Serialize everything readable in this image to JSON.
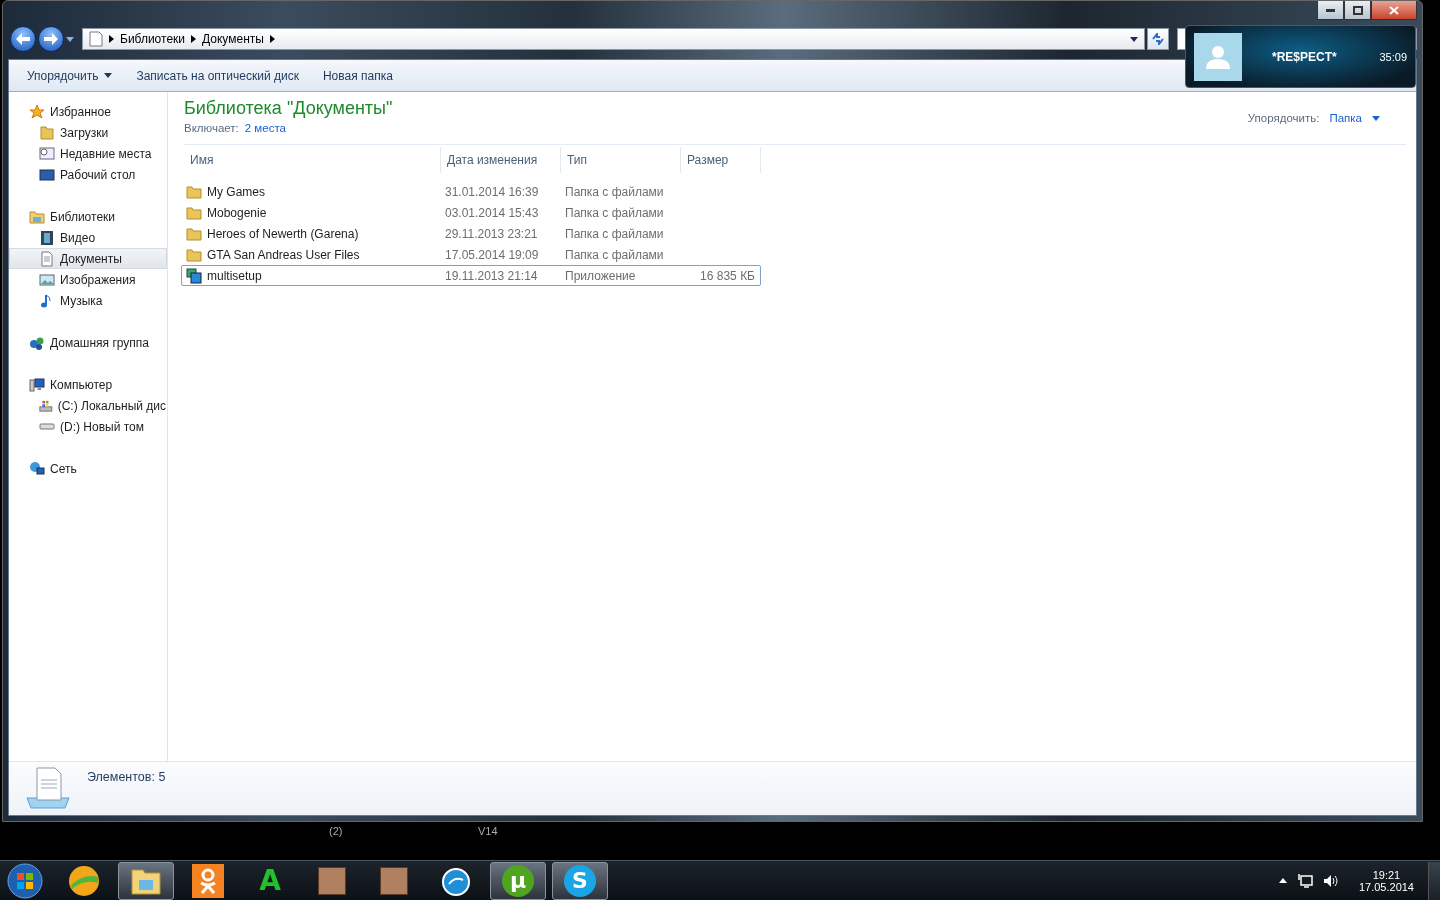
{
  "address_bar": {
    "crumbs": [
      "Библиотеки",
      "Документы"
    ]
  },
  "toolbar": {
    "buttons": [
      {
        "label": "Упорядочить",
        "kind": "menu"
      },
      {
        "label": "Записать на оптический диск",
        "kind": "plain"
      },
      {
        "label": "Новая папка",
        "kind": "plain"
      }
    ]
  },
  "sidebar": {
    "groups": [
      {
        "label": "Избранное",
        "kind": "star",
        "selected": false,
        "children": [
          {
            "label": "Загрузки",
            "kind": "folder",
            "selected": false
          },
          {
            "label": "Недавние места",
            "kind": "recent",
            "selected": false
          },
          {
            "label": "Рабочий стол",
            "kind": "desktop",
            "selected": false
          }
        ]
      },
      {
        "label": "Библиотеки",
        "kind": "library",
        "selected": false,
        "children": [
          {
            "label": "Видео",
            "kind": "video",
            "selected": false
          },
          {
            "label": "Документы",
            "kind": "document",
            "selected": true
          },
          {
            "label": "Изображения",
            "kind": "images",
            "selected": false
          },
          {
            "label": "Музыка",
            "kind": "music",
            "selected": false
          }
        ]
      },
      {
        "label": "Домашняя группа",
        "kind": "homegroup",
        "selected": false
      },
      {
        "label": "Компьютер",
        "kind": "computer",
        "selected": false,
        "children": [
          {
            "label": "(C:) Локальный дис",
            "kind": "drive-c",
            "selected": false
          },
          {
            "label": "(D:) Новый том",
            "kind": "drive-d",
            "selected": false
          }
        ]
      },
      {
        "label": "Сеть",
        "kind": "network",
        "selected": false
      }
    ]
  },
  "library": {
    "title": "Библиотека \"Документы\"",
    "includes_label": "Включает:",
    "includes_link": "2 места",
    "arrange_label": "Упорядочить:",
    "arrange_value": "Папка"
  },
  "table": {
    "columns": [
      "Имя",
      "Дата изменения",
      "Тип",
      "Размер"
    ],
    "rows": [
      {
        "kind": "folder",
        "name": "My Games",
        "date": "31.01.2014 16:39",
        "type": "Папка с файлами",
        "selected": false
      },
      {
        "kind": "folder",
        "name": "Mobogenie",
        "date": "03.01.2014 15:43",
        "type": "Папка с файлами",
        "selected": false
      },
      {
        "kind": "folder",
        "name": "Heroes of Newerth (Garena)",
        "date": "29.11.2013 23:21",
        "type": "Папка с файлами",
        "selected": false
      },
      {
        "kind": "folder",
        "name": "GTA San Andreas User Files",
        "date": "17.05.2014 19:09",
        "type": "Папка с файлами",
        "selected": false
      },
      {
        "kind": "app",
        "name": "multisetup",
        "date": "19.11.2013 21:14",
        "type": "Приложение",
        "size": "16 835 КБ",
        "selected": true
      }
    ]
  },
  "details": {
    "count": "Элементов: 5"
  },
  "desktop_labels": [
    "(2)",
    "V14"
  ],
  "notification": {
    "name": "*RE$PECT*",
    "time": "35:09"
  },
  "taskbar": {
    "apps": [
      {
        "kind": "orb",
        "active": false
      },
      {
        "kind": "explorer",
        "active": true
      },
      {
        "kind": "ok",
        "active": false
      },
      {
        "kind": "letter",
        "label": "A",
        "color": "#22c02a",
        "active": false
      },
      {
        "kind": "photo",
        "active": false
      },
      {
        "kind": "photo",
        "active": false
      },
      {
        "kind": "globe",
        "active": false
      },
      {
        "kind": "letter",
        "label": "µ",
        "color": "#4fa51f",
        "active": true
      },
      {
        "kind": "letter",
        "label": "S",
        "color": "#1aa6e6",
        "active": true
      }
    ]
  },
  "clock": {
    "time": "19:21",
    "date": "17.05.2014"
  }
}
